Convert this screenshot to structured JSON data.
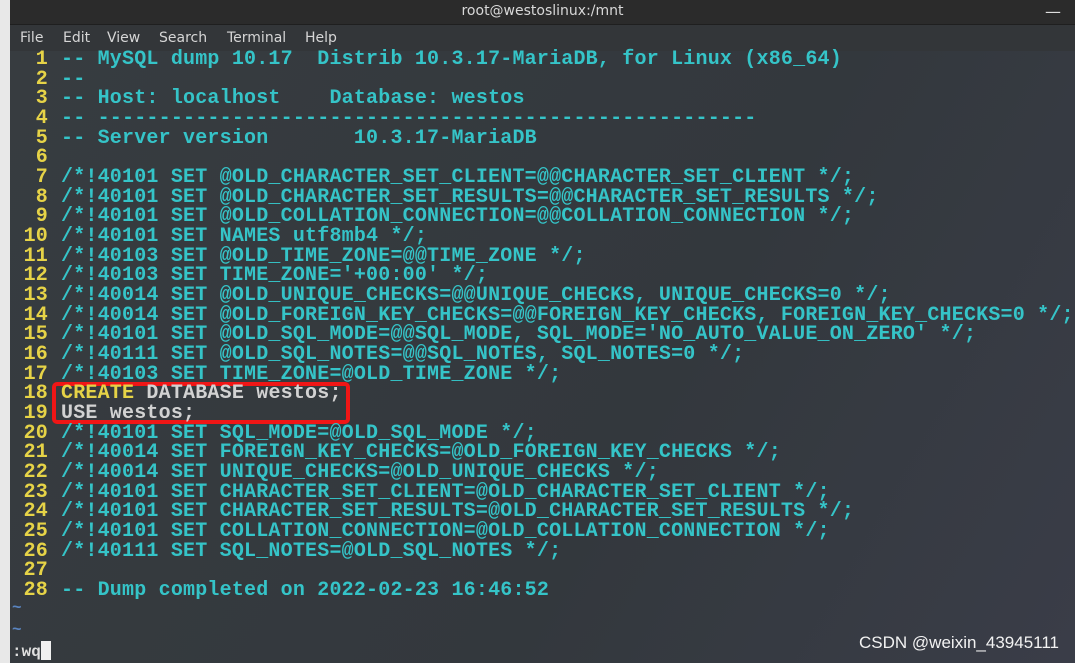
{
  "window": {
    "title": "root@westoslinux:/mnt",
    "minimize_icon": "minimize-icon"
  },
  "menu": [
    "File",
    "Edit",
    "View",
    "Search",
    "Terminal",
    "Help"
  ],
  "lines": [
    {
      "n": "1",
      "text": "-- MySQL dump 10.17  Distrib 10.3.17-MariaDB, for Linux (x86_64)"
    },
    {
      "n": "2",
      "text": "--"
    },
    {
      "n": "3",
      "text": "-- Host: localhost    Database: westos"
    },
    {
      "n": "4",
      "text": "-- ------------------------------------------------------"
    },
    {
      "n": "5",
      "text": "-- Server version       10.3.17-MariaDB"
    },
    {
      "n": "6",
      "text": ""
    },
    {
      "n": "7",
      "text": "/*!40101 SET @OLD_CHARACTER_SET_CLIENT=@@CHARACTER_SET_CLIENT */;"
    },
    {
      "n": "8",
      "text": "/*!40101 SET @OLD_CHARACTER_SET_RESULTS=@@CHARACTER_SET_RESULTS */;"
    },
    {
      "n": "9",
      "text": "/*!40101 SET @OLD_COLLATION_CONNECTION=@@COLLATION_CONNECTION */;"
    },
    {
      "n": "10",
      "text": "/*!40101 SET NAMES utf8mb4 */;"
    },
    {
      "n": "11",
      "text": "/*!40103 SET @OLD_TIME_ZONE=@@TIME_ZONE */;"
    },
    {
      "n": "12",
      "text": "/*!40103 SET TIME_ZONE='+00:00' */;"
    },
    {
      "n": "13",
      "text": "/*!40014 SET @OLD_UNIQUE_CHECKS=@@UNIQUE_CHECKS, UNIQUE_CHECKS=0 */;"
    },
    {
      "n": "14",
      "text": "/*!40014 SET @OLD_FOREIGN_KEY_CHECKS=@@FOREIGN_KEY_CHECKS, FOREIGN_KEY_CHECKS=0 */;"
    },
    {
      "n": "15",
      "text": "/*!40101 SET @OLD_SQL_MODE=@@SQL_MODE, SQL_MODE='NO_AUTO_VALUE_ON_ZERO' */;"
    },
    {
      "n": "16",
      "text": "/*!40111 SET @OLD_SQL_NOTES=@@SQL_NOTES, SQL_NOTES=0 */;"
    },
    {
      "n": "17",
      "text": "/*!40103 SET TIME_ZONE=@OLD_TIME_ZONE */;"
    },
    {
      "n": "18",
      "kw": "CREATE",
      "text": " DATABASE westos;"
    },
    {
      "n": "19",
      "plain": "USE westos;"
    },
    {
      "n": "20",
      "text": "/*!40101 SET SQL_MODE=@OLD_SQL_MODE */;"
    },
    {
      "n": "21",
      "text": "/*!40014 SET FOREIGN_KEY_CHECKS=@OLD_FOREIGN_KEY_CHECKS */;"
    },
    {
      "n": "22",
      "text": "/*!40014 SET UNIQUE_CHECKS=@OLD_UNIQUE_CHECKS */;"
    },
    {
      "n": "23",
      "text": "/*!40101 SET CHARACTER_SET_CLIENT=@OLD_CHARACTER_SET_CLIENT */;"
    },
    {
      "n": "24",
      "text": "/*!40101 SET CHARACTER_SET_RESULTS=@OLD_CHARACTER_SET_RESULTS */;"
    },
    {
      "n": "25",
      "text": "/*!40101 SET COLLATION_CONNECTION=@OLD_COLLATION_CONNECTION */;"
    },
    {
      "n": "26",
      "text": "/*!40111 SET SQL_NOTES=@OLD_SQL_NOTES */;"
    },
    {
      "n": "27",
      "text": ""
    },
    {
      "n": "28",
      "text": "-- Dump completed on 2022-02-23 16:46:52"
    }
  ],
  "tildes": [
    "~",
    "~"
  ],
  "command": ":wq",
  "colors": {
    "highlight_box": "#f01616",
    "text": "#35c4c8",
    "line_numbers": "#e6d347"
  },
  "watermark": "CSDN @weixin_43945111"
}
